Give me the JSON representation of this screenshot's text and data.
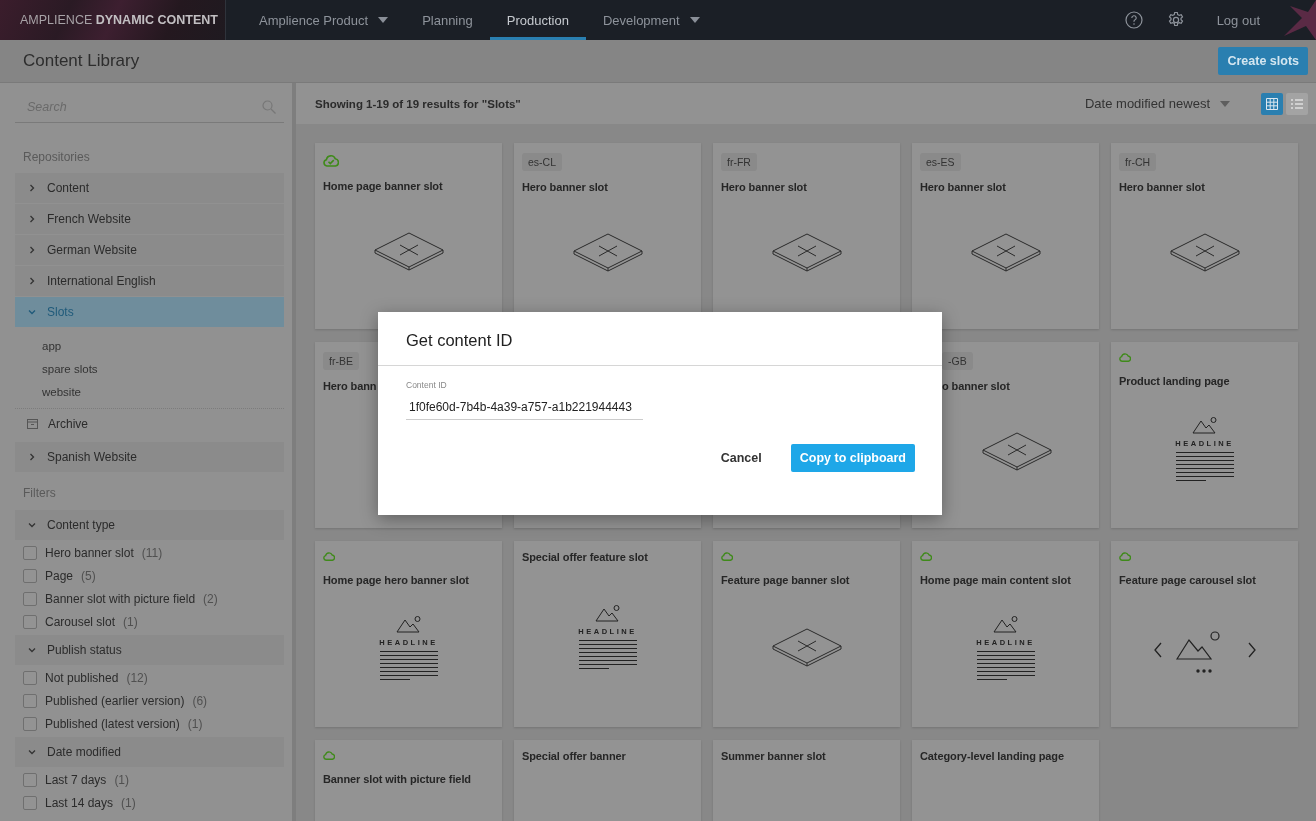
{
  "nav": {
    "brand": "AMPLIENCE **DYNAMIC CONTENT**",
    "items": [
      {
        "label": "Amplience Product",
        "dropdown": true,
        "selected": false
      },
      {
        "label": "Planning",
        "dropdown": false,
        "selected": false
      },
      {
        "label": "Production",
        "dropdown": false,
        "selected": true
      },
      {
        "label": "Development",
        "dropdown": true,
        "selected": false
      }
    ],
    "logout": "Log out"
  },
  "page_header": {
    "title": "Content Library",
    "action": "Create slots"
  },
  "sidebar": {
    "search": {
      "placeholder": "Search"
    },
    "repositories_heading": "Repositories",
    "repositories": [
      {
        "kind": "repository",
        "label": "Content",
        "expanded": false,
        "selected": false
      },
      {
        "kind": "repository",
        "label": "French Website",
        "expanded": false,
        "selected": false
      },
      {
        "kind": "repository",
        "label": "German Website",
        "expanded": false,
        "selected": false
      },
      {
        "kind": "repository",
        "label": "International English",
        "expanded": false,
        "selected": false
      },
      {
        "kind": "repository",
        "label": "Slots",
        "expanded": true,
        "selected": true,
        "children": [
          {
            "label": "app"
          },
          {
            "label": "spare slots"
          },
          {
            "label": "website"
          }
        ]
      },
      {
        "kind": "archive",
        "label": "Archive",
        "selected": false
      },
      {
        "kind": "repository",
        "label": "Spanish Website",
        "expanded": false,
        "selected": false
      }
    ],
    "filters_heading": "Filters",
    "filter_groups": [
      {
        "title": "Content type",
        "expanded": true,
        "options": [
          {
            "label": "Hero banner slot",
            "count": "(11)",
            "checked": false
          },
          {
            "label": "Page",
            "count": "(5)",
            "checked": false
          },
          {
            "label": "Banner slot with picture field",
            "count": "(2)",
            "checked": false
          },
          {
            "label": "Carousel slot",
            "count": "(1)",
            "checked": false
          }
        ]
      },
      {
        "title": "Publish status",
        "expanded": true,
        "options": [
          {
            "label": "Not published",
            "count": "(12)",
            "checked": false
          },
          {
            "label": "Published (earlier version)",
            "count": "(6)",
            "checked": false
          },
          {
            "label": "Published (latest version)",
            "count": "(1)",
            "checked": false
          }
        ]
      },
      {
        "title": "Date modified",
        "expanded": true,
        "options": [
          {
            "label": "Last 7 days",
            "count": "(1)",
            "checked": false
          },
          {
            "label": "Last 14 days",
            "count": "(1)",
            "checked": false
          }
        ]
      }
    ]
  },
  "results": {
    "summary": "Showing 1-19 of 19 results for \"Slots\"",
    "sort": "Date modified newest",
    "views": [
      {
        "kind": "grid",
        "selected": true
      },
      {
        "kind": "list",
        "selected": false
      }
    ]
  },
  "cards": [
    {
      "kind": "slot",
      "published": true,
      "latest": true,
      "title": "Home page banner slot"
    },
    {
      "kind": "slot",
      "published": false,
      "locale": "es-CL",
      "title": "Hero banner slot"
    },
    {
      "kind": "slot",
      "published": false,
      "locale": "fr-FR",
      "title": "Hero banner slot"
    },
    {
      "kind": "slot",
      "published": false,
      "locale": "es-ES",
      "title": "Hero banner slot"
    },
    {
      "kind": "slot",
      "published": false,
      "locale": "fr-CH",
      "title": "Hero banner slot"
    },
    {
      "kind": "text",
      "published": false,
      "locale": "fr-BE",
      "title": "Hero bann"
    },
    {
      "kind": "empty"
    },
    {
      "kind": "empty"
    },
    {
      "kind": "shifted",
      "published": false,
      "locale": "-GB",
      "title": "o banner slot"
    },
    {
      "kind": "page",
      "published": true,
      "latest": false,
      "title": "Product landing page",
      "preview_text": "HEADLINE"
    },
    {
      "kind": "page",
      "published": true,
      "latest": false,
      "title": "Home page hero banner slot",
      "preview_text": "HEADLINE"
    },
    {
      "kind": "page",
      "published": false,
      "title": "Special offer feature slot",
      "preview_text": "HEADLINE"
    },
    {
      "kind": "slot",
      "published": true,
      "latest": false,
      "title": "Feature page banner slot"
    },
    {
      "kind": "page",
      "published": true,
      "latest": false,
      "title": "Home page main content slot",
      "preview_text": "HEADLINE"
    },
    {
      "kind": "carousel",
      "published": true,
      "latest": false,
      "title": "Feature page carousel slot"
    },
    {
      "kind": "text",
      "published": true,
      "latest": false,
      "title": "Banner slot with picture field"
    },
    {
      "kind": "text",
      "published": false,
      "title": "Special offer banner"
    },
    {
      "kind": "text",
      "published": false,
      "title": "Summer banner slot"
    },
    {
      "kind": "text",
      "published": false,
      "title": "Category-level landing page"
    }
  ],
  "dialog": {
    "title": "Get content ID",
    "field_label": "Content ID",
    "field_value": "1f0fe60d-7b4b-4a39-a757-a1b221944443",
    "buttons": [
      {
        "kind": "secondary",
        "label": "Cancel"
      },
      {
        "kind": "primary",
        "label": "Copy to clipboard"
      }
    ]
  }
}
